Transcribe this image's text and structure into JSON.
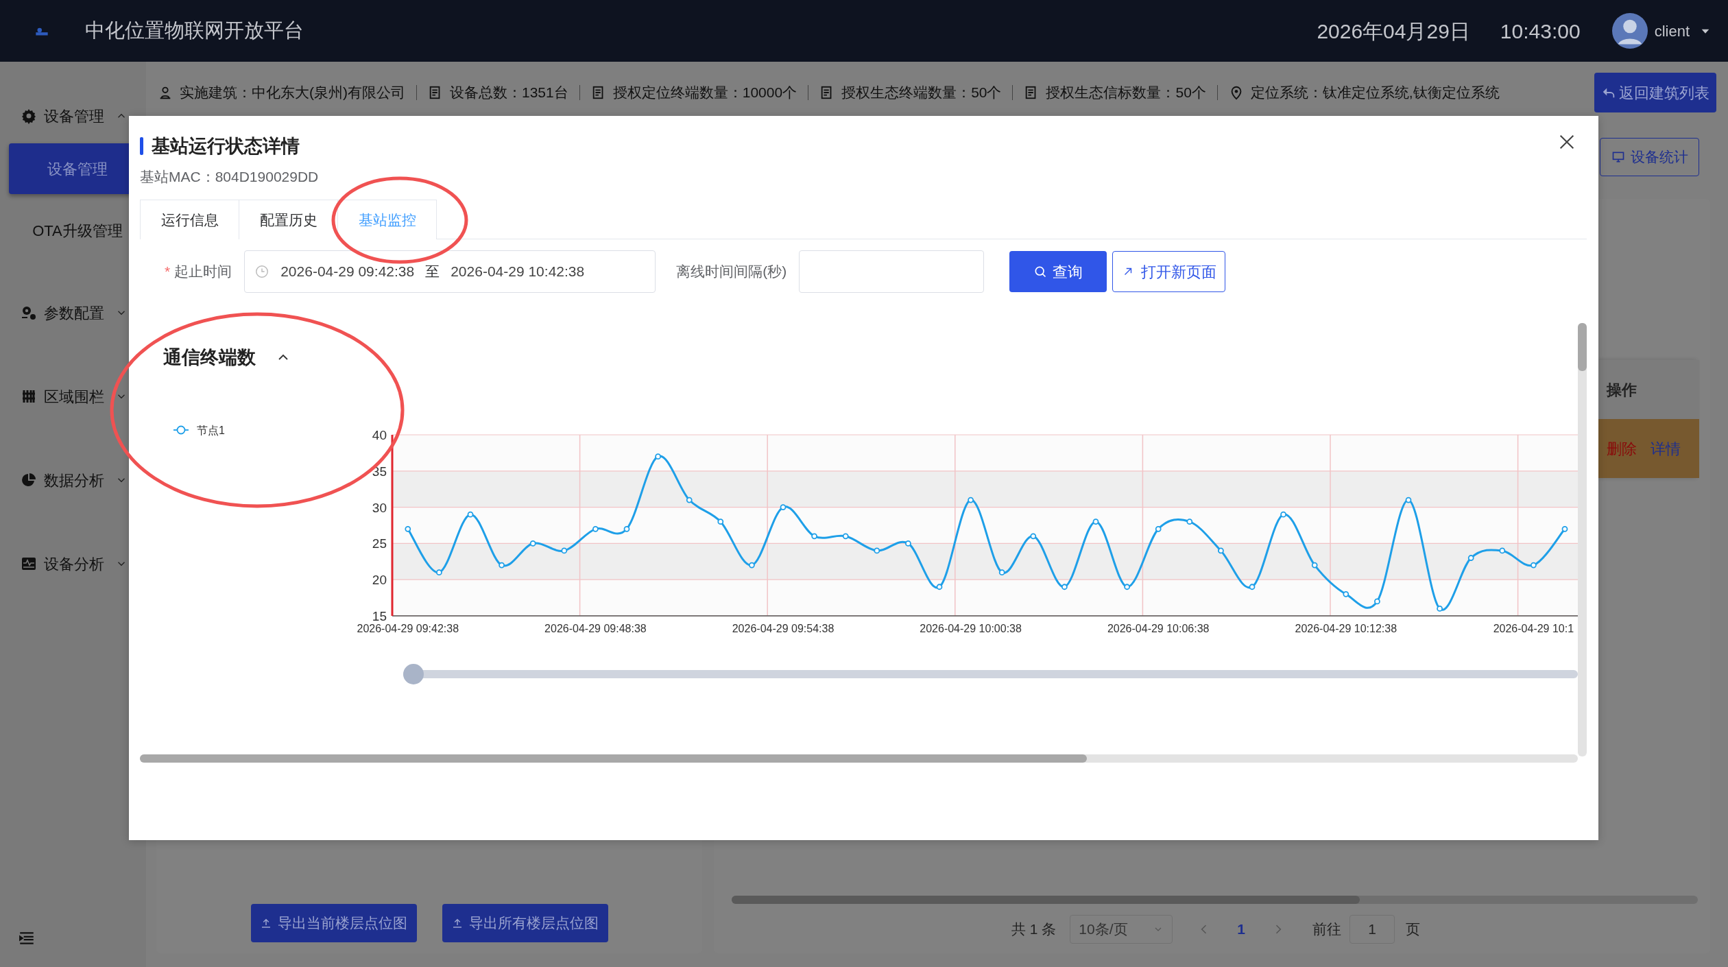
{
  "header": {
    "title": "中化位置物联网开放平台",
    "date": "2026年04月29日",
    "time": "10:43:00",
    "user": "client"
  },
  "sidebar": {
    "items": [
      {
        "label": "设备管理",
        "expanded": true,
        "children": [
          {
            "label": "设备管理",
            "selected": true
          },
          {
            "label": "OTA升级管理",
            "selected": false
          }
        ]
      },
      {
        "label": "参数配置",
        "expanded": false
      },
      {
        "label": "区域围栏",
        "expanded": false
      },
      {
        "label": "数据分析",
        "expanded": false
      },
      {
        "label": "设备分析",
        "expanded": false
      }
    ]
  },
  "info_bar": [
    "实施建筑：中化东大(泉州)有限公司",
    "设备总数：1351台",
    "授权定位终端数量：10000个",
    "授权生态终端数量：50个",
    "授权生态信标数量：50个",
    "定位系统：钛准定位系统,钛衡定位系统"
  ],
  "back_button": "返回建筑列表",
  "stats_button": "设备统计",
  "table": {
    "columns": [
      "操作"
    ],
    "rows": [
      {
        "actions": [
          "删除",
          "详情"
        ]
      }
    ]
  },
  "export_buttons": [
    "导出当前楼层点位图",
    "导出所有楼层点位图"
  ],
  "pagination": {
    "total": "共 1 条",
    "page_size": "10条/页",
    "current_page": "1",
    "goto_label": "前往",
    "goto_value": "1",
    "page_suffix": "页"
  },
  "modal": {
    "title": "基站运行状态详情",
    "mac": "基站MAC：804D190029DD",
    "tabs": [
      {
        "label": "运行信息",
        "selected": false
      },
      {
        "label": "配置历史",
        "selected": false
      },
      {
        "label": "基站监控",
        "selected": true
      }
    ],
    "form": {
      "required_mark": "*",
      "range_label": "起止时间",
      "start": "2026-04-29 09:42:38",
      "separator": "至",
      "end": "2026-04-29 10:42:38",
      "interval_label": "离线时间间隔(秒)",
      "query_button": "查询",
      "open_button": "打开新页面"
    },
    "section": {
      "title": "通信终端数",
      "expanded": true,
      "chart_data": {
        "type": "line",
        "categories": [
          "2026-04-29 09:42:38",
          null,
          null,
          null,
          null,
          null,
          "2026-04-29 09:48:38",
          null,
          null,
          null,
          null,
          null,
          "2026-04-29 09:54:38",
          null,
          null,
          null,
          null,
          null,
          "2026-04-29 10:00:38",
          null,
          null,
          null,
          null,
          null,
          "2026-04-29 10:06:38",
          null,
          null,
          null,
          null,
          null,
          "2026-04-29 10:12:38",
          null,
          null,
          null,
          null,
          null,
          "2026-04-29 10:1",
          null
        ],
        "grid": true,
        "series": [
          {
            "name": "节点1",
            "color": "#1e9fe8",
            "marker": "circle",
            "values": [
              27,
              21,
              29,
              22,
              25,
              24,
              27,
              27,
              37,
              31,
              28,
              22,
              30,
              26,
              26,
              24,
              25,
              19,
              31,
              21,
              26,
              19,
              28,
              19,
              27,
              28,
              24,
              19,
              29,
              22,
              18,
              17,
              31,
              16,
              23,
              24,
              22,
              27
            ]
          }
        ],
        "ylim": [
          15,
          40
        ],
        "yticks": [
          15,
          20,
          25,
          30,
          35,
          40
        ]
      },
      "zoom_slider": {
        "level": 0
      }
    }
  }
}
